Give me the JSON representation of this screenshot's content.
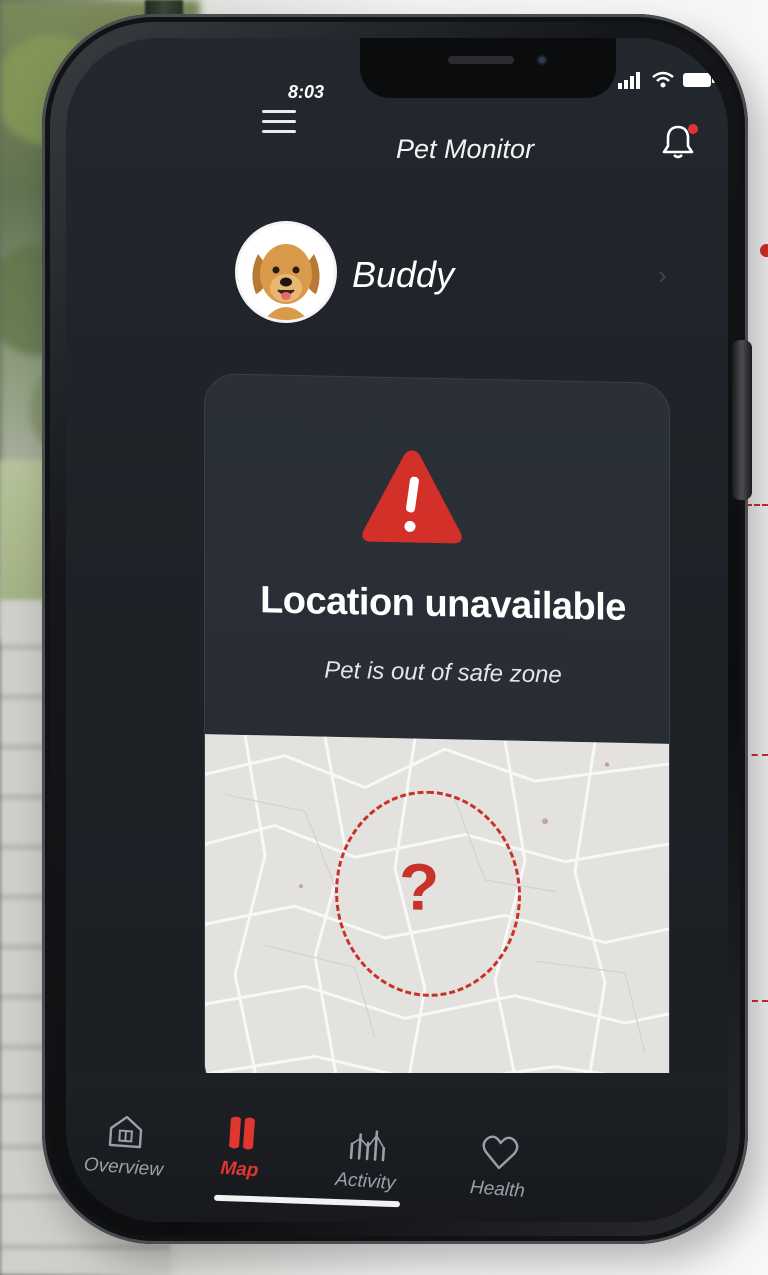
{
  "status_bar": {
    "time": "8:03"
  },
  "header": {
    "title": "Pet Monitor",
    "menu_icon": "hamburger-menu-icon",
    "notification_icon": "bell-icon"
  },
  "pet": {
    "name": "Buddy",
    "avatar_icon": "dog-avatar"
  },
  "alert": {
    "title": "Location unavailable",
    "subtitle": "Pet is out of safe zone",
    "icon": "warning-triangle-icon",
    "marker": "?"
  },
  "bottom_nav": {
    "items": [
      {
        "label": "Overview",
        "icon": "house-icon",
        "active": false
      },
      {
        "label": "Map",
        "icon": "map-pin-icon",
        "active": true
      },
      {
        "label": "Activity",
        "icon": "bar-chart-icon",
        "active": false
      },
      {
        "label": "Health",
        "icon": "heart-icon",
        "active": false
      }
    ]
  },
  "colors": {
    "accent": "#e0362f",
    "screen_bg": "#1e2227",
    "card_bg": "#2b3038",
    "text_primary": "#ffffff",
    "text_muted": "#9aa0a8"
  }
}
